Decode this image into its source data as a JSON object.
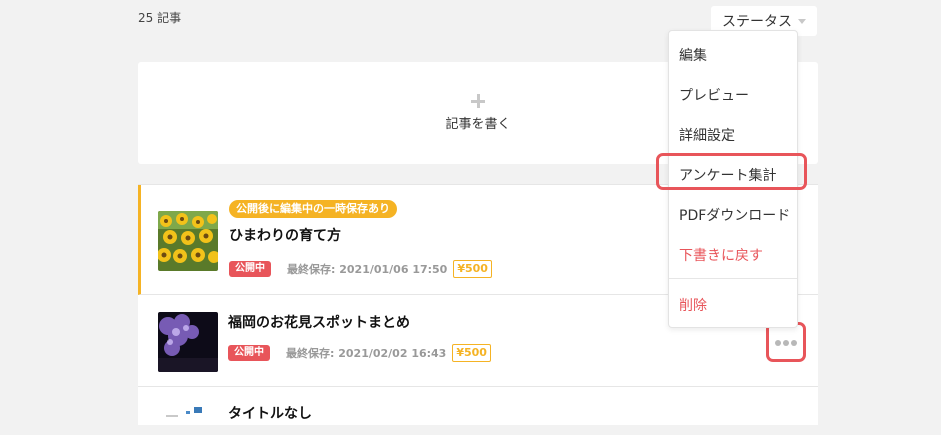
{
  "header": {
    "article_count": "25 記事"
  },
  "status_filter": {
    "label": "ステータス"
  },
  "write_card": {
    "label": "記事を書く"
  },
  "articles": [
    {
      "notice": "公開後に編集中の一時保存あり",
      "title": "ひまわりの育て方",
      "status": "公開中",
      "saved": "最終保存: 2021/01/06 17:50",
      "price": "¥500"
    },
    {
      "title": "福岡のお花見スポットまとめ",
      "status": "公開中",
      "saved": "最終保存: 2021/02/02 16:43",
      "price": "¥500"
    },
    {
      "title": "タイトルなし"
    }
  ],
  "menu": {
    "items": [
      "編集",
      "プレビュー",
      "詳細設定",
      "アンケート集計",
      "PDFダウンロード",
      "下書きに戻す",
      "削除"
    ]
  },
  "colors": {
    "accent_red": "#e8555a",
    "accent_yellow": "#f5b324",
    "background": "#f2f2f2"
  },
  "icons": [
    "plus-icon",
    "caret-down-icon",
    "more-dots-icon"
  ]
}
